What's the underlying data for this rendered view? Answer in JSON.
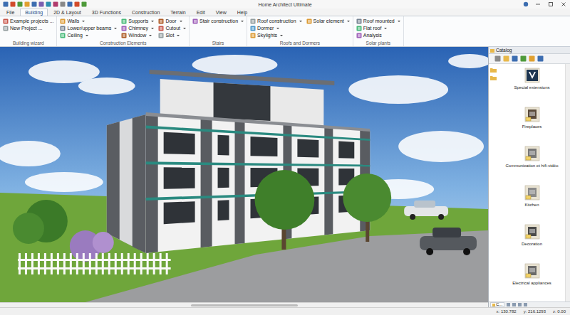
{
  "window": {
    "title": "Home Architect Ultimate"
  },
  "menu_tabs": [
    {
      "label": "File",
      "selected": false
    },
    {
      "label": "Building",
      "selected": true
    },
    {
      "label": "2D & Layout",
      "selected": false
    },
    {
      "label": "3D Functions",
      "selected": false
    },
    {
      "label": "Construction",
      "selected": false
    },
    {
      "label": "Terrain",
      "selected": false
    },
    {
      "label": "Edit",
      "selected": false
    },
    {
      "label": "View",
      "selected": false
    },
    {
      "label": "Help",
      "selected": false
    }
  ],
  "ribbon_groups": [
    {
      "title": "Building wizard",
      "columns": [
        [
          {
            "label": "Example projects ...",
            "dropdown": false
          },
          {
            "label": "New Project ...",
            "dropdown": false
          }
        ]
      ]
    },
    {
      "title": "Construction Elements",
      "columns": [
        [
          {
            "label": "Walls",
            "dropdown": true
          },
          {
            "label": "Lower/upper beams",
            "dropdown": true
          },
          {
            "label": "Ceiling",
            "dropdown": true
          }
        ],
        [
          {
            "label": "Supports",
            "dropdown": true
          },
          {
            "label": "Chimney",
            "dropdown": true
          },
          {
            "label": "Window",
            "dropdown": true
          }
        ],
        [
          {
            "label": "Door",
            "dropdown": true
          },
          {
            "label": "Cutout",
            "dropdown": true
          },
          {
            "label": "Slot",
            "dropdown": true
          }
        ]
      ]
    },
    {
      "title": "Stairs",
      "columns": [
        [
          {
            "label": "Stair construction",
            "dropdown": true
          }
        ]
      ]
    },
    {
      "title": "Roofs and Dormers",
      "columns": [
        [
          {
            "label": "Roof construction",
            "dropdown": true
          },
          {
            "label": "Dormer",
            "dropdown": true
          },
          {
            "label": "Skylights",
            "dropdown": true
          }
        ],
        [
          {
            "label": "Solar element",
            "dropdown": true
          }
        ]
      ]
    },
    {
      "title": "Solar plants",
      "columns": [
        [
          {
            "label": "Roof mounted",
            "dropdown": true
          },
          {
            "label": "Flat roof",
            "dropdown": true
          },
          {
            "label": "Analysis",
            "dropdown": false
          }
        ]
      ]
    }
  ],
  "catalog": {
    "title": "Catalog",
    "items": [
      {
        "label": "Special extensions"
      },
      {
        "label": "Fireplaces"
      },
      {
        "label": "Communication et hifi-vidéo"
      },
      {
        "label": "Kitchen"
      },
      {
        "label": "Decoration"
      },
      {
        "label": "Electrical appliances"
      }
    ],
    "bottom_tab": "C..."
  },
  "status_bar": {
    "x": "x: 130.782",
    "y": "y: 216.1293",
    "z": "z: 0.00"
  }
}
